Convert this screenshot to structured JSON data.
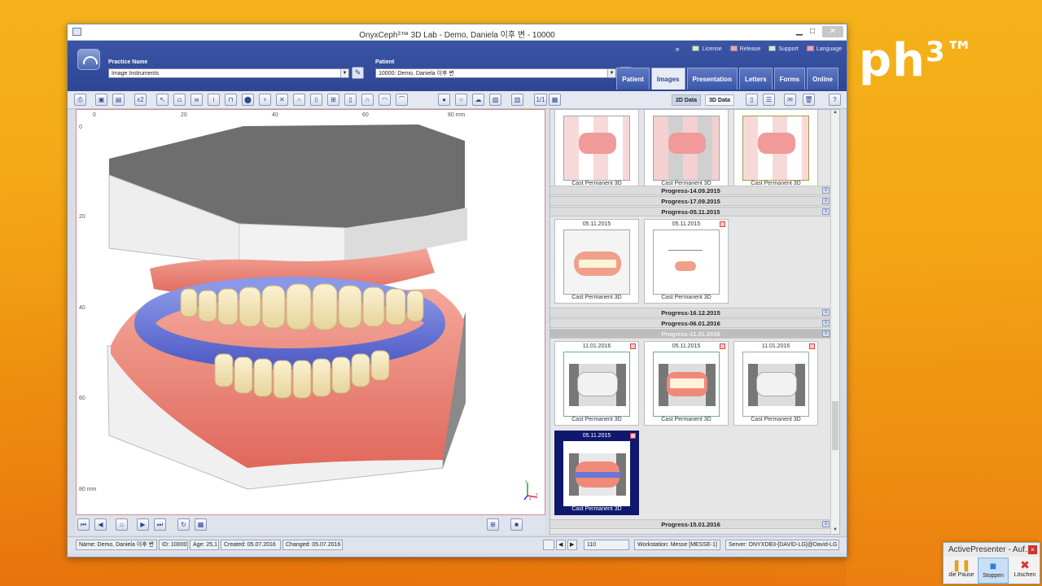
{
  "brand_text": "ph",
  "brand_sup": "3™",
  "window": {
    "title": "OnyxCeph³™ 3D Lab - Demo, Daniela 이후 변 - 10000",
    "min_label": "▁",
    "max_label": "□",
    "close_label": "✕"
  },
  "header": {
    "chevron": "»",
    "links": [
      {
        "label": "License",
        "color": "#c8f0c8"
      },
      {
        "label": "Release",
        "color": "#f4a0b0"
      },
      {
        "label": "Support",
        "color": "#c8f0c8"
      },
      {
        "label": "Language",
        "color": "#f4a0b0"
      }
    ],
    "practice_label": "Practice Name",
    "practice_value": "Image Instruments",
    "patient_label": "Patient",
    "patient_value": "10000: Demo, Daniela 이후 변",
    "tabs": [
      {
        "label": "Patient",
        "active": false
      },
      {
        "label": "Images",
        "active": true
      },
      {
        "label": "Presentation",
        "active": false
      },
      {
        "label": "Letters",
        "active": false
      },
      {
        "label": "Forms",
        "active": false
      },
      {
        "label": "Online",
        "active": false
      }
    ]
  },
  "toolbar": {
    "zoom_label": "x2",
    "page_label": "1/1",
    "data2d_label": "2D Data",
    "data3d_label": "3D Data"
  },
  "viewer": {
    "ruler_top": [
      "0",
      "20",
      "40",
      "60",
      "80 mm"
    ],
    "ruler_left": [
      "0",
      "20",
      "40",
      "60",
      "80 mm"
    ],
    "axis_y": "y",
    "axis_x": "x",
    "axis_z": "z"
  },
  "gallery": {
    "row1": [
      {
        "date": "",
        "caption": "Cast Permanent 3D",
        "style": "normal"
      },
      {
        "date": "",
        "caption": "Cast Permanent 3D",
        "style": "gray"
      },
      {
        "date": "",
        "caption": "Cast Permanent 3D",
        "style": "olive"
      }
    ],
    "sections_a": [
      "Progress-14.09.2015",
      "Progress-17.09.2015",
      "Progress-05.11.2015"
    ],
    "row2": [
      {
        "date": "05.11.2015",
        "caption": "Cast Permanent 3D"
      },
      {
        "date": "05.11.2015",
        "caption": "Cast Permanent 3D"
      }
    ],
    "sections_b": [
      "Progress-16.12.2015",
      "Progress-06.01.2016",
      "Progress-11.01.2016"
    ],
    "row3": [
      {
        "date": "11.01.2016",
        "caption": "Cast Permanent 3D"
      },
      {
        "date": "05.11.2015",
        "caption": "Cast Permanent 3D"
      },
      {
        "date": "11.01.2016",
        "caption": "Cast Permanent 3D"
      }
    ],
    "row4": [
      {
        "date": "05.11.2015",
        "caption": "Cast Permanent 3D"
      }
    ],
    "section_last": "Progress-15.01.2016"
  },
  "status": {
    "name": "Name: Demo, Daniela 이후 변",
    "id": "ID: 10000",
    "age": "Age: 25,1",
    "created": "Created: 05.07.2016",
    "changed": "Changed: 05.07.2016",
    "zoom_value": "110",
    "workstation": "Workstation: Messe [MESSE-1]",
    "server": "Server: ONYXDB3-[DAVID-LG]@David-LG"
  },
  "activepresenter": {
    "title": "ActivePresenter - Auf...",
    "pause_label": "die Pause",
    "stop_label": "Stoppen",
    "delete_label": "Löschen"
  }
}
